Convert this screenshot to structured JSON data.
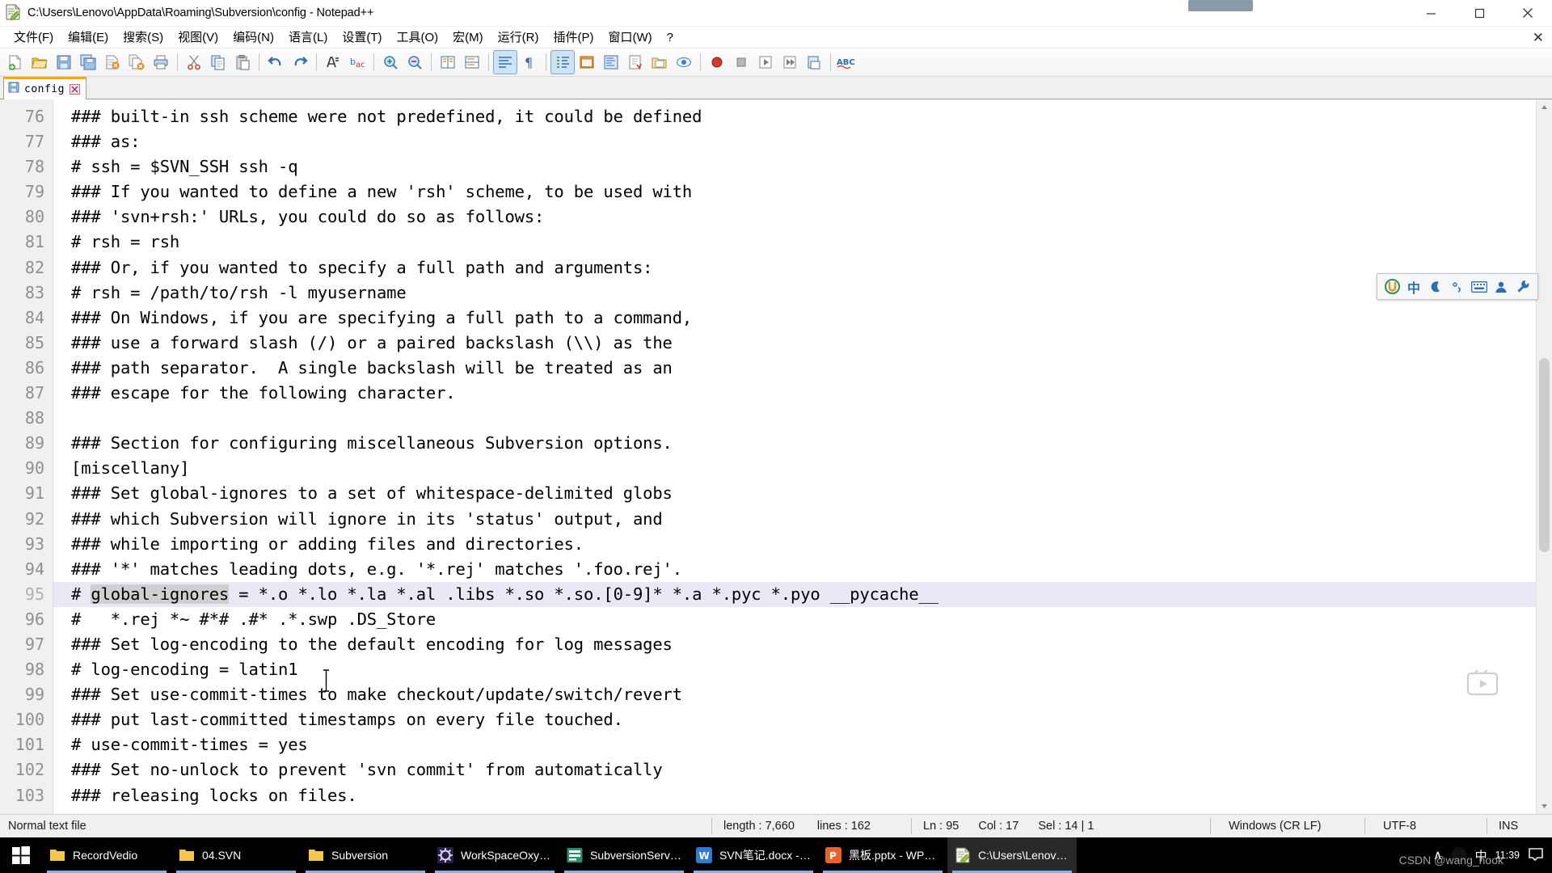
{
  "window": {
    "title": "C:\\Users\\Lenovo\\AppData\\Roaming\\Subversion\\config - Notepad++",
    "icon": "notepad-plus-plus-icon",
    "minimize_label": "─",
    "maximize_label": "❐",
    "close_label": "✕"
  },
  "menubar": {
    "items": [
      {
        "label": "文件(F)",
        "name": "menu-file"
      },
      {
        "label": "编辑(E)",
        "name": "menu-edit"
      },
      {
        "label": "搜索(S)",
        "name": "menu-search"
      },
      {
        "label": "视图(V)",
        "name": "menu-view"
      },
      {
        "label": "编码(N)",
        "name": "menu-encoding"
      },
      {
        "label": "语言(L)",
        "name": "menu-language"
      },
      {
        "label": "设置(T)",
        "name": "menu-settings"
      },
      {
        "label": "工具(O)",
        "name": "menu-tools"
      },
      {
        "label": "宏(M)",
        "name": "menu-macro"
      },
      {
        "label": "运行(R)",
        "name": "menu-run"
      },
      {
        "label": "插件(P)",
        "name": "menu-plugins"
      },
      {
        "label": "窗口(W)",
        "name": "menu-window"
      },
      {
        "label": "?",
        "name": "menu-help"
      }
    ],
    "doc_close_label": "✕"
  },
  "toolbar": {
    "buttons": [
      "new-file-icon",
      "open-file-icon",
      "save-icon",
      "save-all-icon",
      "close-file-icon",
      "close-all-icon",
      "print-icon",
      "cut-icon",
      "copy-icon",
      "paste-icon",
      "undo-icon",
      "redo-icon",
      "find-icon",
      "replace-icon",
      "zoom-in-icon",
      "zoom-out-icon",
      "sync-vertical-icon",
      "sync-horizontal-icon",
      "word-wrap-icon",
      "show-all-chars-icon",
      "indent-guide-icon",
      "user-defined-dialog-icon",
      "doc-map-icon",
      "function-list-icon",
      "folder-as-workspace-icon",
      "monitoring-icon",
      "macro-record-icon",
      "macro-stop-icon",
      "macro-play-icon",
      "macro-playback-multiple-icon",
      "macro-save-icon",
      "spell-check-icon"
    ]
  },
  "tabs": [
    {
      "label": "config",
      "icon": "saved-file-icon",
      "close_label": "✖",
      "active": true
    }
  ],
  "editor": {
    "first_line_number": 76,
    "current_line": 95,
    "selected_token": "global-ignores",
    "lines": [
      {
        "n": 76,
        "text": "### built-in ssh scheme were not predefined, it could be defined"
      },
      {
        "n": 77,
        "text": "### as:"
      },
      {
        "n": 78,
        "text": "# ssh = $SVN_SSH ssh -q"
      },
      {
        "n": 79,
        "text": "### If you wanted to define a new 'rsh' scheme, to be used with"
      },
      {
        "n": 80,
        "text": "### 'svn+rsh:' URLs, you could do so as follows:"
      },
      {
        "n": 81,
        "text": "# rsh = rsh"
      },
      {
        "n": 82,
        "text": "### Or, if you wanted to specify a full path and arguments:"
      },
      {
        "n": 83,
        "text": "# rsh = /path/to/rsh -l myusername"
      },
      {
        "n": 84,
        "text": "### On Windows, if you are specifying a full path to a command,"
      },
      {
        "n": 85,
        "text": "### use a forward slash (/) or a paired backslash (\\\\) as the"
      },
      {
        "n": 86,
        "text": "### path separator.  A single backslash will be treated as an"
      },
      {
        "n": 87,
        "text": "### escape for the following character."
      },
      {
        "n": 88,
        "text": ""
      },
      {
        "n": 89,
        "text": "### Section for configuring miscellaneous Subversion options."
      },
      {
        "n": 90,
        "text": "[miscellany]"
      },
      {
        "n": 91,
        "text": "### Set global-ignores to a set of whitespace-delimited globs"
      },
      {
        "n": 92,
        "text": "### which Subversion will ignore in its 'status' output, and"
      },
      {
        "n": 93,
        "text": "### while importing or adding files and directories."
      },
      {
        "n": 94,
        "text": "### '*' matches leading dots, e.g. '*.rej' matches '.foo.rej'."
      },
      {
        "n": 95,
        "text": "# global-ignores = *.o *.lo *.la *.al .libs *.so *.so.[0-9]* *.a *.pyc *.pyo __pycache__",
        "current": true,
        "prefix": "# ",
        "token": "global-ignores",
        "suffix": " = *.o *.lo *.la *.al .libs *.so *.so.[0-9]* *.a *.pyc *.pyo __pycache__"
      },
      {
        "n": 96,
        "text": "#   *.rej *~ #*# .#* .*.swp .DS_Store"
      },
      {
        "n": 97,
        "text": "### Set log-encoding to the default encoding for log messages"
      },
      {
        "n": 98,
        "text": "# log-encoding = latin1"
      },
      {
        "n": 99,
        "text": "### Set use-commit-times to make checkout/update/switch/revert"
      },
      {
        "n": 100,
        "text": "### put last-committed timestamps on every file touched."
      },
      {
        "n": 101,
        "text": "# use-commit-times = yes"
      },
      {
        "n": 102,
        "text": "### Set no-unlock to prevent 'svn commit' from automatically"
      },
      {
        "n": 103,
        "text": "### releasing locks on files."
      }
    ]
  },
  "ime": {
    "icons": [
      "sogou-logo-icon",
      "chinese-mode-icon",
      "half-width-moon-icon",
      "punctuation-icon",
      "soft-keyboard-icon",
      "user-icon",
      "tools-wrench-icon"
    ],
    "chinese_label": "中"
  },
  "statusbar": {
    "file_type": "Normal text file",
    "length_label": "length : 7,660",
    "lines_label": "lines : 162",
    "ln_label": "Ln : 95",
    "col_label": "Col : 17",
    "sel_label": "Sel : 14 | 1",
    "eol": "Windows (CR LF)",
    "encoding": "UTF-8",
    "insert_mode": "INS"
  },
  "taskbar": {
    "start_name": "start-button",
    "items": [
      {
        "label": "RecordVedio",
        "icon": "folder-icon",
        "focused": false
      },
      {
        "label": "04.SVN",
        "icon": "folder-icon",
        "focused": false
      },
      {
        "label": "Subversion",
        "icon": "folder-icon",
        "focused": false
      },
      {
        "label": "WorkSpaceOxyg...",
        "icon": "oxygen-icon",
        "focused": false
      },
      {
        "label": "SubversionServe...",
        "icon": "subversion-server-icon",
        "focused": false
      },
      {
        "label": "SVN笔记.docx - ...",
        "icon": "word-icon",
        "focused": false
      },
      {
        "label": "黑板.pptx - WPS ...",
        "icon": "powerpoint-icon",
        "focused": false
      },
      {
        "label": "C:\\Users\\Lenovo...",
        "icon": "notepad-plus-plus-icon",
        "focused": true
      }
    ],
    "tray": {
      "chevron": "∧",
      "ime_label": "中",
      "time": "11:39",
      "watermark": "CSDN @wang_hook"
    }
  },
  "colors": {
    "tab_accent": "#ffa500",
    "current_line": "#e9e9f6",
    "selection": "#cfcfcf",
    "taskbar_bg": "#000000",
    "taskbar_underline": "#76b9ed",
    "gutter_bg": "#f0f0f0",
    "gutter_text": "#8f8f8f"
  }
}
